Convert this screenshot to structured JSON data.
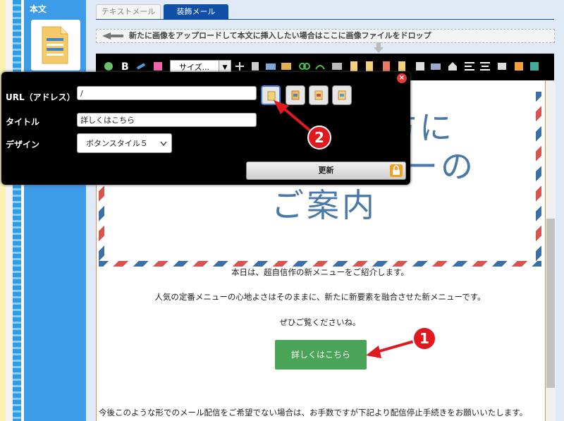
{
  "sidebar": {
    "label": "本文"
  },
  "tabs": {
    "text_mail": "テキストメール",
    "deco_mail": "装飾メール"
  },
  "dropzone": {
    "text": "新たに画像をアップロードして本文に挿入したい場合はここに画像ファイルをドロップ"
  },
  "toolbar": {
    "size_select": "サイズ...",
    "bold": "B"
  },
  "dialog": {
    "url_label": "URL（アドレス）",
    "url_value": "/",
    "title_label": "タイトル",
    "title_value": "詳しくはこちら",
    "design_label": "デザイン",
    "design_value": "ボタンスタイル５",
    "update_label": "更新",
    "close_symbol": "×"
  },
  "content": {
    "heading_line1": "方に",
    "heading_line2": "ーの",
    "heading_line3": "ご案内",
    "para1": "本日は、超自信作の新メニューをご紹介します。",
    "para2": "人気の定番メニューの心地よさはそのままに、新たに新要素を融合させた新メニューです。",
    "para3": "ぜひご覧くださいね。",
    "cta_label": "詳しくはこちら",
    "footer": "今後このような形でのメール配信をご希望でない場合は、お手数ですが下記より配信停止手続きをお願いいたします。"
  },
  "annotations": {
    "badge1": "1",
    "badge2": "2"
  },
  "colors": {
    "sidebar": "#3d9ce8",
    "tab_active": "#0f4fa8",
    "cta": "#4aa457",
    "badge": "#e0191f",
    "heading": "#4a78a8"
  }
}
